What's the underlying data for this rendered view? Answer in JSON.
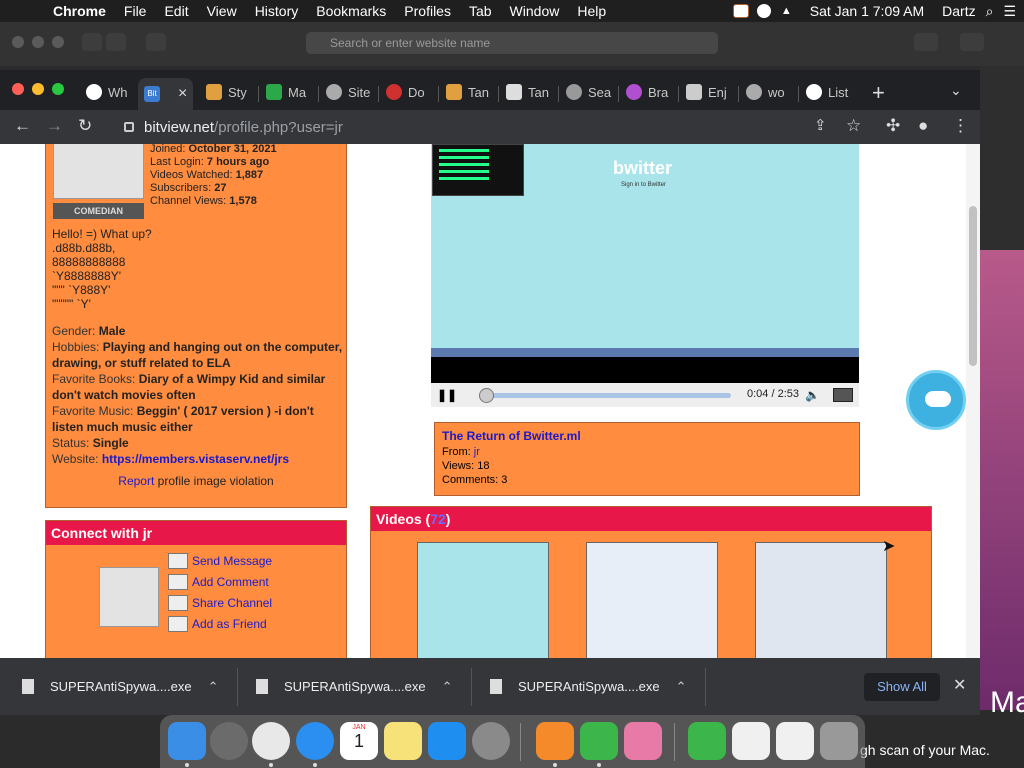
{
  "menubar": {
    "app_name": "Chrome",
    "menus": [
      "File",
      "Edit",
      "View",
      "History",
      "Bookmarks",
      "Profiles",
      "Tab",
      "Window",
      "Help"
    ],
    "clock": "Sat Jan 1  7:09 AM",
    "user": "Dartz"
  },
  "background_window": {
    "address_placeholder": "Search or enter website name"
  },
  "background_text": {
    "big": "Mac",
    "small": "gh scan of your Mac."
  },
  "tabs": [
    {
      "label": "Wh",
      "favicon_color": "#ffffff"
    },
    {
      "label": "",
      "favicon_color": "#3b7bd0",
      "active": true,
      "close": "×"
    },
    {
      "label": "Sty",
      "favicon_color": "#e0a040"
    },
    {
      "label": "Ma",
      "favicon_color": "#2aa84a"
    },
    {
      "label": "Site",
      "favicon_color": "#aaaaaa"
    },
    {
      "label": "Do",
      "favicon_color": "#d03030"
    },
    {
      "label": "Tan",
      "favicon_color": "#e0a040"
    },
    {
      "label": "Tan",
      "favicon_color": "#dddddd"
    },
    {
      "label": "Sea",
      "favicon_color": "#999999"
    },
    {
      "label": "Bra",
      "favicon_color": "#b050d0"
    },
    {
      "label": "Enj",
      "favicon_color": "#cccccc"
    },
    {
      "label": "wo",
      "favicon_color": "#aaaaaa"
    },
    {
      "label": "List",
      "favicon_color": "#ffffff"
    }
  ],
  "active_tab_favicon_text": "Bit",
  "url": {
    "host": "bitview.net",
    "path": "/profile.php?user=jr"
  },
  "profile": {
    "badge": "COMEDIAN",
    "stats": [
      {
        "label": "Joined:",
        "value": "October 31, 2021"
      },
      {
        "label": "Last Login:",
        "value": "7 hours ago"
      },
      {
        "label": "Videos Watched:",
        "value": "1,887"
      },
      {
        "label": "Subscribers:",
        "value": "27"
      },
      {
        "label": "Channel Views:",
        "value": "1,578"
      }
    ],
    "bio": "Hello! =) What up?\n.d88b.d88b,\n88888888888\n`Y8888888Y'\n\"\"\" `Y888Y'\n\"\"\"\"\" `Y'",
    "gender_label": "Gender:",
    "gender": "Male",
    "hobbies_label": "Hobbies:",
    "hobbies": "Playing and hanging out on the computer, drawing, or stuff related to ELA",
    "books_label": "Favorite Books:",
    "books": "Diary of a Wimpy Kid and similar don't watch movies often",
    "music_label": "Favorite Music:",
    "music": "Beggin' ( 2017 version ) -i don't listen much music either",
    "status_label": "Status:",
    "status": "Single",
    "website_label": "Website:",
    "website": "https://members.vistaserv.net/jrs",
    "report_link": "Report",
    "report_text": " profile image violation"
  },
  "connect": {
    "title": "Connect with jr",
    "actions": [
      "Send Message",
      "Add Comment",
      "Share Channel",
      "Add as Friend"
    ]
  },
  "video": {
    "screen_logo": "bwitter",
    "screen_sub": "Sign in to Bwitter",
    "time": "0:04 / 2:53",
    "progress": 0.023,
    "title": "The Return of Bwitter.ml",
    "from_label": "From:",
    "from": "jr",
    "views": "Views: 18",
    "comments": "Comments: 3"
  },
  "videos": {
    "title": "Videos (",
    "count": "72",
    "title_end": ")"
  },
  "downloads": {
    "files": [
      "SUPERAntiSpywa....exe",
      "SUPERAntiSpywa....exe",
      "SUPERAntiSpywa....exe"
    ],
    "show_all": "Show All"
  },
  "dock": {
    "icons": [
      "finder-icon",
      "launchpad-icon",
      "chrome-icon",
      "safari-icon",
      "calendar-icon",
      "notes-icon",
      "app-store-icon",
      "system-preferences-icon",
      "vlc-icon",
      "vpn-icon",
      "flashcards-icon",
      "antivirus-icon",
      "document-icon",
      "preview-icon",
      "trash-icon"
    ],
    "icon_colors": [
      "#3a8ee6",
      "#6b6b6b",
      "#e8e8e8",
      "#2a8ff0",
      "#ffffff",
      "#f7e27a",
      "#1e8ff0",
      "#8a8a8a",
      "#f58a2a",
      "#3cb54a",
      "#e87aa8",
      "#3cb54a",
      "#f0f0f0",
      "#f0f0f0",
      "#999999"
    ],
    "calendar_month": "JAN",
    "calendar_day": "1"
  }
}
